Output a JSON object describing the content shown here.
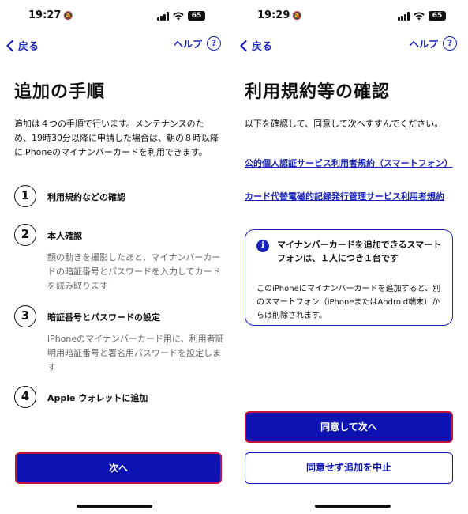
{
  "left": {
    "status_time": "19:27",
    "battery": "65",
    "back_label": "戻る",
    "help_label": "ヘルプ",
    "help_icon": "?",
    "title": "追加の手順",
    "intro": "追加は４つの手順で行います。メンテナンスのため、19時30分以降に申請した場合は、朝の８時以降にiPhoneのマイナンバーカードを利用できます。",
    "steps": [
      {
        "num": "1",
        "label": "利用規約などの確認",
        "desc": ""
      },
      {
        "num": "2",
        "label": "本人確認",
        "desc": "顔の動きを撮影したあと、マイナンバーカードの暗証番号とパスワードを入力してカードを読み取ります"
      },
      {
        "num": "3",
        "label": "暗証番号とパスワードの設定",
        "desc": "iPhoneのマイナンバーカード用に、利用者証明用暗証番号と署名用パスワードを設定します"
      },
      {
        "num": "4",
        "label": "Apple ウォレットに追加",
        "desc": ""
      }
    ],
    "next_button": "次へ"
  },
  "right": {
    "status_time": "19:29",
    "battery": "65",
    "back_label": "戻る",
    "help_label": "ヘルプ",
    "help_icon": "?",
    "title": "利用規約等の確認",
    "description": "以下を確認して、同意して次へすすんでください。",
    "links": [
      "公的個人認証サービス利用者規約（スマートフォン）",
      "カード代替電磁的記録発行管理サービス利用者規約"
    ],
    "notice": {
      "icon": "i",
      "title": "マイナンバーカードを追加できるスマートフォンは、１人につき１台です",
      "body": "このiPhoneにマイナンバーカードを追加すると、別のスマートフォン（iPhoneまたはAndroid端末）からは削除されます。"
    },
    "agree_button": "同意して次へ",
    "disagree_button": "同意せず追加を中止"
  },
  "colors": {
    "accent": "#1a24b8",
    "primary_button": "#0d12b3",
    "button_border": "#c2143a"
  }
}
